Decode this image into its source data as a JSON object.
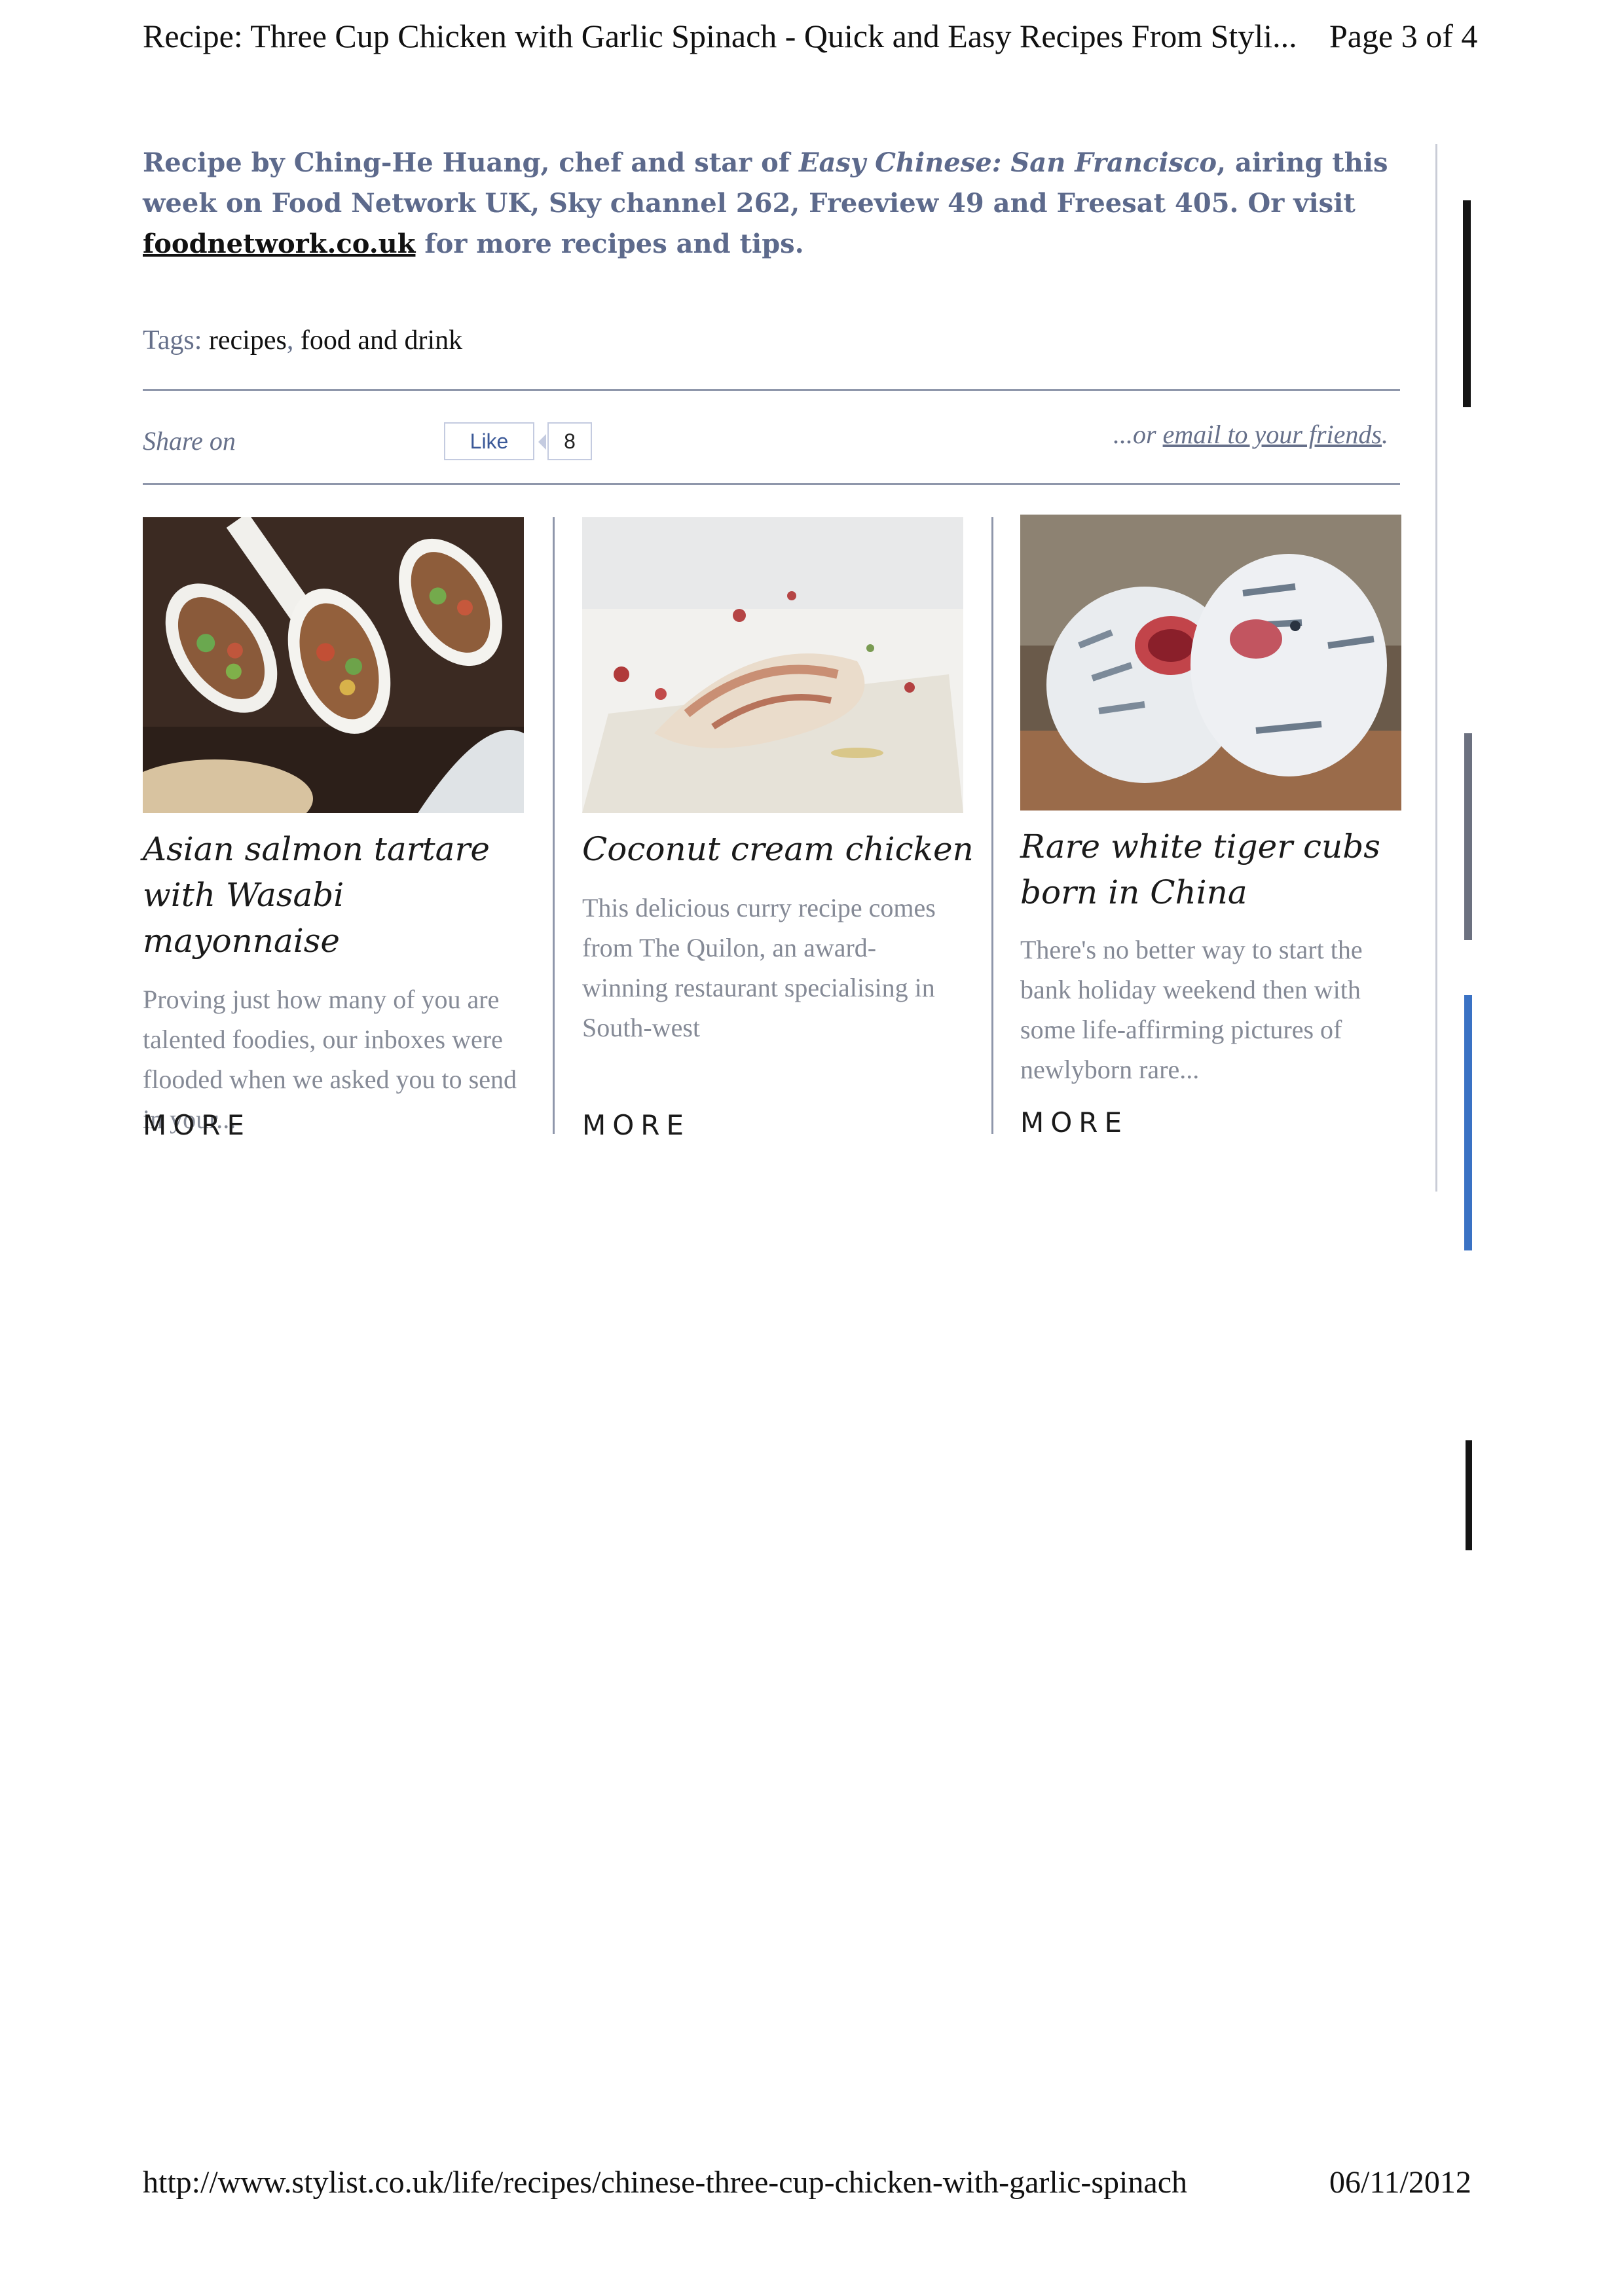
{
  "print_header": {
    "title": "Recipe: Three Cup Chicken with Garlic Spinach - Quick and Easy Recipes From Styli...",
    "page": "Page 3 of 4"
  },
  "credit": {
    "prefix": "Recipe by Ching-He Huang, chef and star of ",
    "show_name": "Easy Chinese: San Francisco",
    "middle": ", airing this week on Food Network UK, Sky channel 262, Freeview 49 and Freesat 405. Or visit ",
    "link": "foodnetwork.co.uk",
    "suffix": " for more recipes and tips."
  },
  "tags": {
    "label": "Tags: ",
    "items": [
      "recipes",
      "food and drink"
    ],
    "separator": ", "
  },
  "share": {
    "label": "Share on",
    "like_label": "Like",
    "like_count": "8",
    "email_prefix": "...or ",
    "email_link": "email to your friends",
    "email_suffix": "."
  },
  "cards": [
    {
      "title": "Asian salmon tartare with Wasabi mayonnaise",
      "description": "Proving just how many of you are talented foodies, our inboxes were flooded when we asked you to send in your...",
      "more": "More",
      "image": "salmon-tartare-spoons-photo"
    },
    {
      "title": "Coconut cream chicken",
      "description": "This delicious curry recipe comes from The Quilon, an award-winning restaurant specialising in South-west",
      "more": "More",
      "image": "coconut-chicken-plate-photo"
    },
    {
      "title": "Rare white tiger cubs born in China",
      "description": "There's no better way to start the bank holiday weekend then with some life-affirming pictures of newlyborn rare...",
      "more": "More",
      "image": "white-tiger-cubs-photo"
    }
  ],
  "print_footer": {
    "url": "http://www.stylist.co.uk/life/recipes/chinese-three-cup-chicken-with-garlic-spinach",
    "date": "06/11/2012"
  },
  "colors": {
    "credit_text": "#5d6a8c",
    "muted_text": "#858a96",
    "rule": "#8f97ab",
    "scroll_blue": "#3a72c4"
  }
}
